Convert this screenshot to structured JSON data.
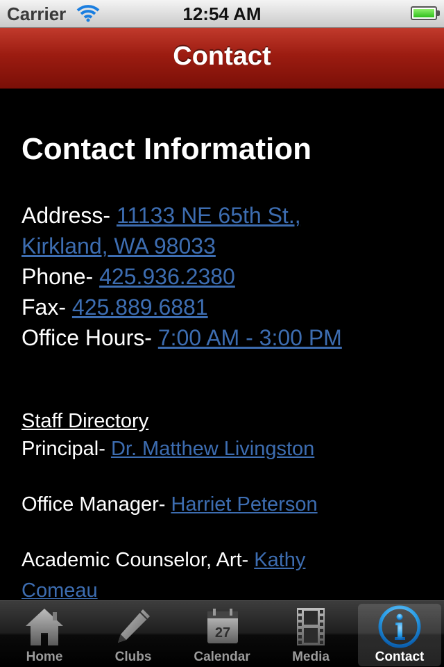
{
  "status_bar": {
    "carrier": "Carrier",
    "time": "12:54 AM"
  },
  "nav": {
    "title": "Contact"
  },
  "content": {
    "heading": "Contact Information",
    "address_label": "Address- ",
    "address_line1": "11133 NE 65th St.,",
    "address_line2": "Kirkland, WA 98033",
    "phone_label": "Phone- ",
    "phone": "425.936.2380",
    "fax_label": "Fax- ",
    "fax": "425.889.6881",
    "hours_label": "Office Hours- ",
    "hours": "7:00 AM - 3:00 PM",
    "staff_heading": "Staff Directory",
    "staff": [
      {
        "role": "Principal- ",
        "name": "Dr. Matthew Livingston"
      },
      {
        "role": "Office Manager- ",
        "name": "Harriet Peterson"
      },
      {
        "role": "Academic Counselor, Art- ",
        "name_line1": "Kathy",
        "name_line2": "Comeau"
      }
    ]
  },
  "tabs": [
    {
      "label": "Home",
      "icon": "home-icon"
    },
    {
      "label": "Clubs",
      "icon": "pencil-icon"
    },
    {
      "label": "Calendar",
      "icon": "calendar-icon",
      "calendar_day": "27"
    },
    {
      "label": "Media",
      "icon": "film-icon"
    },
    {
      "label": "Contact",
      "icon": "info-icon",
      "active": true
    }
  ],
  "colors": {
    "nav_red": "#9c1c11",
    "link_blue": "#3d6db1",
    "active_tab_blue": "#2a9fe8"
  }
}
